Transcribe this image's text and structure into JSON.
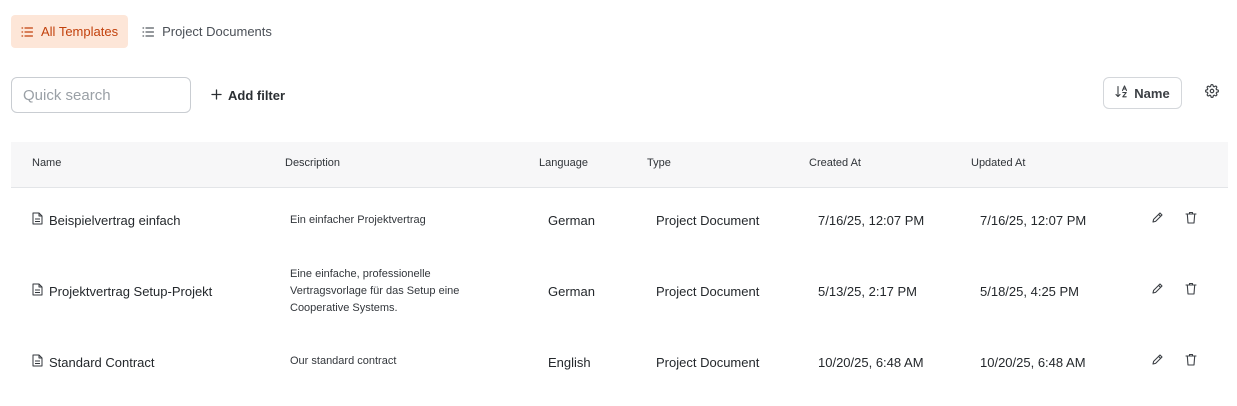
{
  "tabs": [
    {
      "label": "All Templates",
      "active": true
    },
    {
      "label": "Project Documents",
      "active": false
    }
  ],
  "toolbar": {
    "search_placeholder": "Quick search",
    "add_filter_label": "Add filter",
    "sort_label": "Name"
  },
  "table": {
    "headers": [
      "Name",
      "Description",
      "Language",
      "Type",
      "Created At",
      "Updated At"
    ],
    "rows": [
      {
        "name": "Beispielvertrag einfach",
        "description": "Ein einfacher Projektvertrag",
        "language": "German",
        "type": "Project Document",
        "created_at": "7/16/25, 12:07 PM",
        "updated_at": "7/16/25, 12:07 PM"
      },
      {
        "name": "Projektvertrag Setup-Projekt",
        "description": "Eine einfache, professionelle Vertragsvorlage für das Setup eine Cooperative Systems.",
        "language": "German",
        "type": "Project Document",
        "created_at": "5/13/25, 2:17 PM",
        "updated_at": "5/18/25, 4:25 PM"
      },
      {
        "name": "Standard Contract",
        "description": "Our standard contract",
        "language": "English",
        "type": "Project Document",
        "created_at": "10/20/25, 6:48 AM",
        "updated_at": "10/20/25, 6:48 AM"
      }
    ]
  },
  "colors": {
    "accent": "#c2410c",
    "accent_bg": "#fde6d8",
    "header_bg": "#f7f7f8"
  },
  "icons": {
    "tab": "list-icon",
    "add_filter": "plus-icon",
    "sort": "sort-az-icon",
    "settings": "gear-icon",
    "row": "document-icon",
    "edit": "pencil-icon",
    "delete": "trash-icon"
  }
}
